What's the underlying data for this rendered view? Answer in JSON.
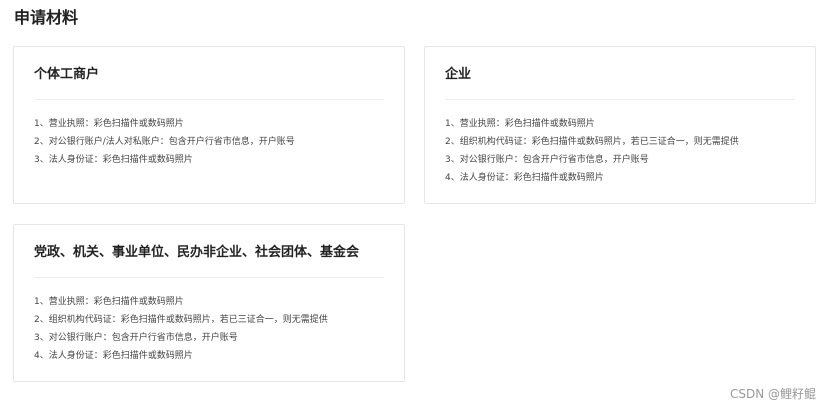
{
  "page": {
    "title": "申请材料"
  },
  "cards": [
    {
      "title": "个体工商户",
      "items": [
        "1、营业执照：彩色扫描件或数码照片",
        "2、对公银行账户/法人对私账户：包含开户行省市信息，开户账号",
        "3、法人身份证：彩色扫描件或数码照片"
      ]
    },
    {
      "title": "企业",
      "items": [
        "1、营业执照：彩色扫描件或数码照片",
        "2、组织机构代码证：彩色扫描件或数码照片，若已三证合一，则无需提供",
        "3、对公银行账户：包含开户行省市信息，开户账号",
        "4、法人身份证：彩色扫描件或数码照片"
      ]
    },
    {
      "title": "党政、机关、事业单位、民办非企业、社会团体、基金会",
      "items": [
        "1、营业执照：彩色扫描件或数码照片",
        "2、组织机构代码证：彩色扫描件或数码照片，若已三证合一，则无需提供",
        "3、对公银行账户：包含开户行省市信息，开户账号",
        "4、法人身份证：彩色扫描件或数码照片"
      ]
    }
  ],
  "watermark": "CSDN @鲤籽鲲"
}
